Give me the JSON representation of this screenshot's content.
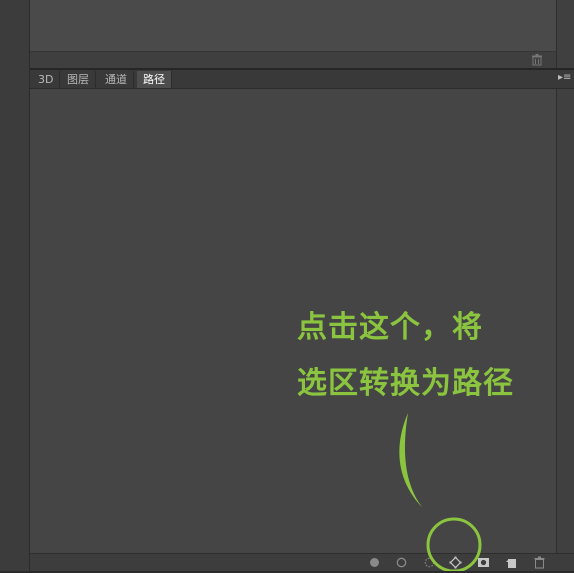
{
  "tabs": [
    {
      "label": "3D",
      "active": false
    },
    {
      "label": "图层",
      "active": false
    },
    {
      "label": "通道",
      "active": false
    },
    {
      "label": "路径",
      "active": true
    }
  ],
  "annotation": {
    "line1": "点击这个，将",
    "line2": "选区转换为路径",
    "color": "#8bc53f"
  },
  "bottom_icons": [
    "fill-path-icon",
    "stroke-path-icon",
    "load-path-as-selection-icon",
    "make-work-path-from-selection-icon",
    "add-mask-icon",
    "new-path-icon",
    "delete-path-icon"
  ],
  "top_icons": [
    "trash-icon"
  ],
  "colors": {
    "panel_bg": "#454545",
    "accent": "#8bc53f"
  }
}
